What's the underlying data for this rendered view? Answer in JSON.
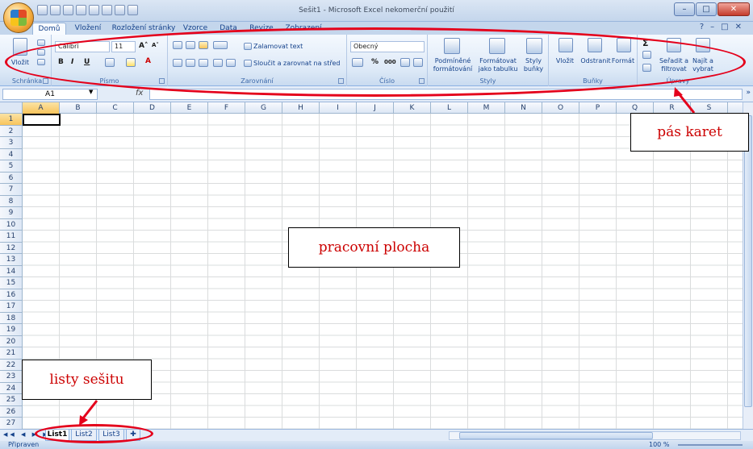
{
  "window": {
    "title": "Sešit1 - Microsoft Excel nekomerční použití",
    "minimize": "–",
    "maximize": "□",
    "close": "✕"
  },
  "tabs": [
    "Domů",
    "Vložení",
    "Rozložení stránky",
    "Vzorce",
    "Data",
    "Revize",
    "Zobrazení"
  ],
  "ribbon": {
    "clipboard": {
      "paste": "Vložit",
      "group": "Schránka"
    },
    "font": {
      "name": "Calibri",
      "size": "11",
      "bold": "B",
      "italic": "I",
      "underline": "U",
      "grow": "A˄",
      "shrink": "A˅",
      "group": "Písmo"
    },
    "alignment": {
      "wrap": "Zalamovat text",
      "merge": "Sloučit a zarovnat na střed",
      "group": "Zarovnání"
    },
    "number": {
      "format": "Obecný",
      "percent": "%",
      "thousands": "000",
      "group": "Číslo"
    },
    "styles": {
      "conditional": "Podmíněné formátování",
      "as_table": "Formátovat jako tabulku",
      "cell_styles": "Styly buňky",
      "group": "Styly"
    },
    "cells": {
      "insert": "Vložit",
      "delete": "Odstranit",
      "format": "Formát",
      "group": "Buňky"
    },
    "editing": {
      "sum": "Σ",
      "sort": "Seřadit a filtrovat",
      "find": "Najít a vybrat",
      "group": "Úpravy"
    }
  },
  "formula_bar": {
    "name_box": "A1",
    "fx": "fx"
  },
  "columns": [
    "A",
    "B",
    "C",
    "D",
    "E",
    "F",
    "G",
    "H",
    "I",
    "J",
    "K",
    "L",
    "M",
    "N",
    "O",
    "P",
    "Q",
    "R",
    "S"
  ],
  "rows": [
    "1",
    "2",
    "3",
    "4",
    "5",
    "6",
    "7",
    "8",
    "9",
    "10",
    "11",
    "12",
    "13",
    "14",
    "15",
    "16",
    "17",
    "18",
    "19",
    "20",
    "21",
    "22",
    "23",
    "24",
    "25",
    "26",
    "27"
  ],
  "sheets": [
    "List1",
    "List2",
    "List3"
  ],
  "status": {
    "text": "Připraven",
    "zoom": "100 %"
  },
  "annotations": {
    "ribbon": "pás karet",
    "workspace": "pracovní plocha",
    "sheets": "listy sešitu"
  },
  "colors": {
    "annotation_red": "#e4001b",
    "ribbon_blue": "#15428b"
  }
}
